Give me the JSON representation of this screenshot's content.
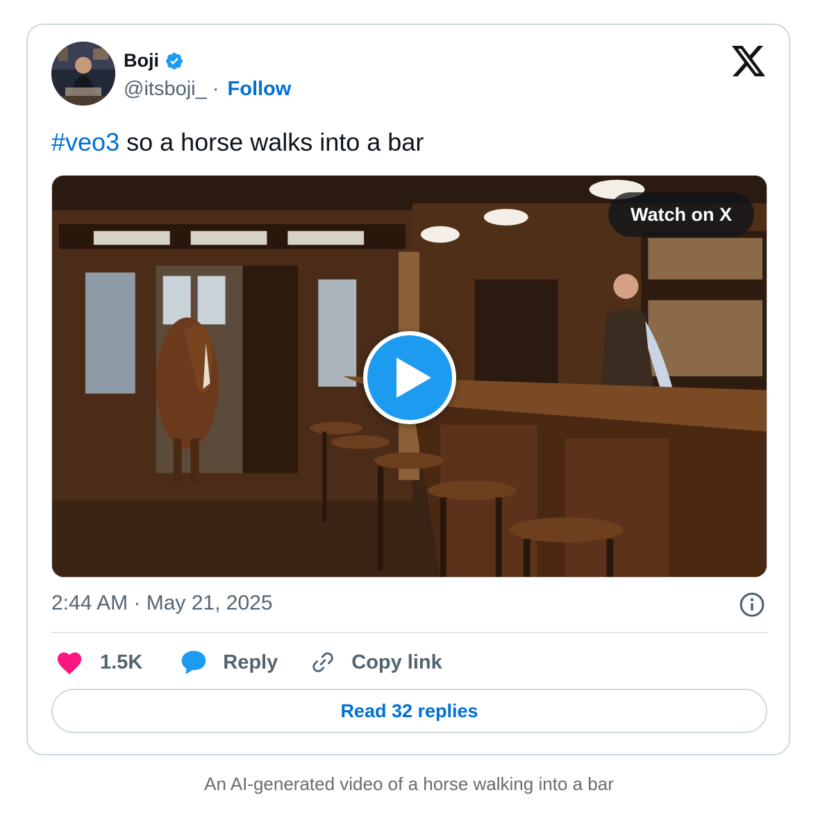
{
  "author": {
    "name": "Boji",
    "handle": "@itsboji_",
    "separator": "·",
    "follow_label": "Follow",
    "verified": true
  },
  "tweet": {
    "hashtag": "#veo3",
    "text": " so a horse walks into a bar"
  },
  "media": {
    "watch_label": "Watch on X"
  },
  "meta": {
    "timestamp": "2:44 AM · May 21, 2025"
  },
  "actions": {
    "likes": "1.5K",
    "reply_label": "Reply",
    "copy_label": "Copy link"
  },
  "read_replies_label": "Read 32 replies",
  "caption": "An AI-generated video of a horse walking into a bar",
  "colors": {
    "link": "#006fd6",
    "like": "#f91880",
    "reply": "#1d9bf0",
    "border": "#cfd9de",
    "muted": "#536471"
  },
  "icons": [
    "verified-badge-icon",
    "x-logo-icon",
    "play-icon",
    "info-icon",
    "heart-icon",
    "reply-bubble-icon",
    "link-icon"
  ]
}
